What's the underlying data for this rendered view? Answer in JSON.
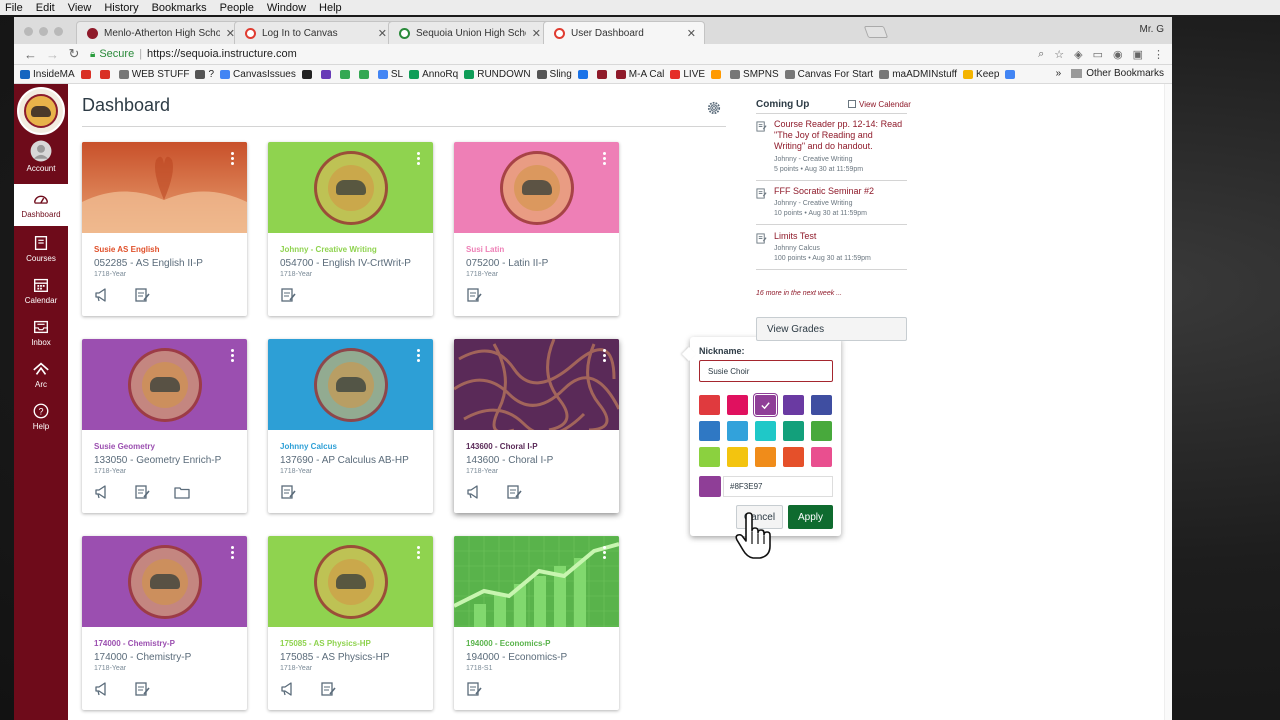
{
  "menubar": {
    "items": [
      "File",
      "Edit",
      "View",
      "History",
      "Bookmarks",
      "People",
      "Window",
      "Help"
    ]
  },
  "browser": {
    "tabs": [
      {
        "title": "Menlo-Atherton High School -",
        "icon_color": "#8f1a2a"
      },
      {
        "title": "Log In to Canvas",
        "icon_color": "#e03c31"
      },
      {
        "title": "Sequoia Union High School Di",
        "icon_color": "#2a8a3a"
      },
      {
        "title": "User Dashboard",
        "icon_color": "#e03c31"
      }
    ],
    "profile": "Mr. G",
    "secure_label": "Secure",
    "url": "https://sequoia.instructure.com",
    "bookmarks": [
      {
        "label": "InsideMA",
        "color": "#1565c0"
      },
      {
        "label": "",
        "color": "#d93025"
      },
      {
        "label": "",
        "color": "#d93025"
      },
      {
        "label": "WEB STUFF",
        "color": "#777777"
      },
      {
        "label": "?",
        "color": "#555555"
      },
      {
        "label": "CanvasIssues",
        "color": "#4285f4"
      },
      {
        "label": "",
        "color": "#222222"
      },
      {
        "label": "",
        "color": "#673ab7"
      },
      {
        "label": "",
        "color": "#34a853"
      },
      {
        "label": "",
        "color": "#34a853"
      },
      {
        "label": "SL",
        "color": "#4285f4"
      },
      {
        "label": "AnnoRq",
        "color": "#0f9d58"
      },
      {
        "label": "RUNDOWN",
        "color": "#0f9d58"
      },
      {
        "label": "Sling",
        "color": "#555555"
      },
      {
        "label": "",
        "color": "#1a73e8"
      },
      {
        "label": "",
        "color": "#8f1a2a"
      },
      {
        "label": "M-A Cal",
        "color": "#8f1a2a"
      },
      {
        "label": "LIVE",
        "color": "#e52d27"
      },
      {
        "label": "",
        "color": "#ff9900"
      },
      {
        "label": "SMPNS",
        "color": "#777777"
      },
      {
        "label": "Canvas For Start",
        "color": "#777777"
      },
      {
        "label": "maADMINstuff",
        "color": "#777777"
      },
      {
        "label": "Keep",
        "color": "#f4b400"
      },
      {
        "label": "",
        "color": "#4285f4"
      }
    ],
    "other_bookmarks": "Other Bookmarks"
  },
  "global_nav": {
    "items": [
      {
        "label": "Account",
        "icon": "account-icon"
      },
      {
        "label": "Dashboard",
        "icon": "dashboard-icon"
      },
      {
        "label": "Courses",
        "icon": "courses-icon"
      },
      {
        "label": "Calendar",
        "icon": "calendar-icon"
      },
      {
        "label": "Inbox",
        "icon": "inbox-icon"
      },
      {
        "label": "Arc",
        "icon": "arc-icon"
      },
      {
        "label": "Help",
        "icon": "help-icon"
      }
    ],
    "active": "Dashboard"
  },
  "dashboard": {
    "title": "Dashboard",
    "cards": [
      {
        "nickname": "Susie AS English",
        "code": "052285 - AS English II-P",
        "term": "1718-Year",
        "color": "#e0502a",
        "hero": "book",
        "actions": [
          "announcements-icon",
          "assignments-icon"
        ]
      },
      {
        "nickname": "Johnny - Creative Writing",
        "code": "054700 - English IV-CrtWrit-P",
        "term": "1718-Year",
        "color": "#8fd34f",
        "hero": "seal",
        "actions": [
          "assignments-icon"
        ]
      },
      {
        "nickname": "Susi Latin",
        "code": "075200 - Latin II-P",
        "term": "1718-Year",
        "color": "#ee7fb6",
        "hero": "seal",
        "actions": [
          "assignments-icon"
        ]
      },
      {
        "nickname": "Susie Geometry",
        "code": "133050 - Geometry Enrich-P",
        "term": "1718-Year",
        "color": "#9b4fb0",
        "hero": "seal",
        "actions": [
          "announcements-icon",
          "assignments-icon",
          "files-icon"
        ]
      },
      {
        "nickname": "Johnny Calcus",
        "code": "137690 - AP Calculus AB-HP",
        "term": "1718-Year",
        "color": "#2d9fd6",
        "hero": "seal",
        "actions": [
          "assignments-icon"
        ]
      },
      {
        "nickname": "143600 - Choral I-P",
        "code": "143600 - Choral I-P",
        "term": "1718-Year",
        "color": "#5a2a58",
        "hero": "pattern",
        "actions": [
          "announcements-icon",
          "assignments-icon"
        ]
      },
      {
        "nickname": "174000 - Chemistry-P",
        "code": "174000 - Chemistry-P",
        "term": "1718-Year",
        "color": "#9b4fb0",
        "hero": "seal",
        "actions": [
          "announcements-icon",
          "assignments-icon"
        ]
      },
      {
        "nickname": "175085 - AS Physics-HP",
        "code": "175085 - AS Physics-HP",
        "term": "1718-Year",
        "color": "#8fd34f",
        "hero": "seal",
        "actions": [
          "announcements-icon",
          "assignments-icon"
        ]
      },
      {
        "nickname": "194000 - Economics-P",
        "code": "194000 - Economics-P",
        "term": "1718-S1",
        "color": "#59b34b",
        "hero": "chart",
        "actions": [
          "assignments-icon"
        ]
      }
    ]
  },
  "coming_up": {
    "title": "Coming Up",
    "view_calendar": "View Calendar",
    "items": [
      {
        "title": "Course Reader pp. 12-14: Read \"The Joy of Reading and Writing\" and do handout.",
        "course": "Johnny - Creative Writing",
        "meta": "5 points • Aug 30 at 11:59pm"
      },
      {
        "title": "FFF Socratic Seminar #2",
        "course": "Johnny - Creative Writing",
        "meta": "10 points • Aug 30 at 11:59pm"
      },
      {
        "title": "Limits Test",
        "course": "Johnny Calcus",
        "meta": "100 points • Aug 30 at 11:59pm"
      }
    ],
    "more": "16 more in the next week ...",
    "view_grades": "View Grades"
  },
  "nickname_popover": {
    "label": "Nickname:",
    "value": "Susie Choir",
    "swatches": [
      "#e03a3e",
      "#e0115f",
      "#8f3e97",
      "#6a3aa2",
      "#3f4ea1",
      "#2f78c4",
      "#32a2db",
      "#1fc8c8",
      "#13a07b",
      "#48a93c",
      "#8bd13f",
      "#f3c40f",
      "#f08c1a",
      "#e5502a",
      "#e94f8f"
    ],
    "selected": "#8f3e97",
    "hex_value": "#8F3E97",
    "cancel_label": "Cancel",
    "apply_label": "Apply"
  }
}
